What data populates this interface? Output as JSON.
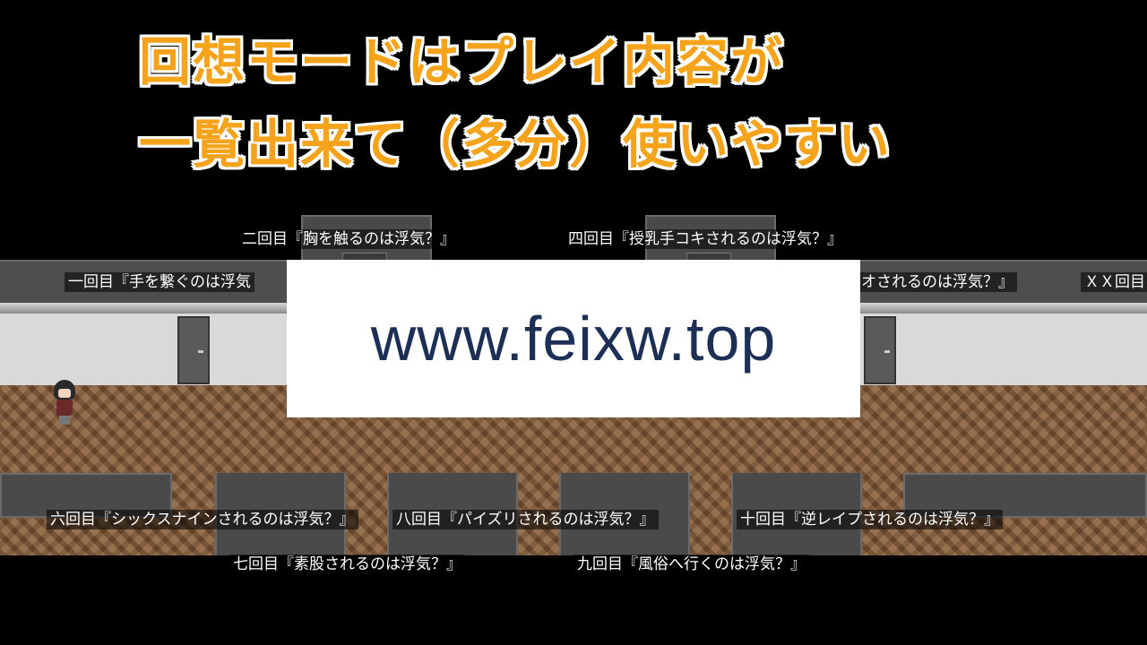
{
  "caption": {
    "line1": "回想モードはプレイ内容が",
    "line2": "一覧出来て（多分）使いやすい"
  },
  "scenes": {
    "row_top_upper": [
      "二回目『胸を触るのは浮気？』",
      "四回目『授乳手コキされるのは浮気？』"
    ],
    "row_top_lower": [
      "一回目『手を繋ぐのは浮気",
      "チオされるのは浮気？』",
      "ＸＸ回目"
    ],
    "row_bottom_upper": [
      "六回目『シックスナインされるのは浮気？』",
      "八回目『パイズリされるのは浮気？』",
      "十回目『逆レイプされるのは浮気？』"
    ],
    "row_bottom_lower": [
      "七回目『素股されるのは浮気？』",
      "九回目『風俗へ行くのは浮気？』"
    ]
  },
  "watermark": {
    "text": "www.feixw.top"
  },
  "colors": {
    "caption": "#f5a31a",
    "caption_outline": "#ffffff",
    "background": "#000000",
    "floor": "#8a5f3a",
    "watermark_text": "#1d2f55"
  }
}
